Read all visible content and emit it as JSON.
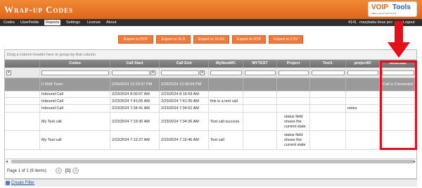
{
  "header": {
    "title": "Wrap-up Codes"
  },
  "logo": {
    "voip": "VOIP",
    "tools": "Tools",
    "tagline": "Making Cloud VoIP Simple"
  },
  "nav": {
    "items": [
      "Codes",
      "UserFields",
      "Reports",
      "Settings",
      "License",
      "About"
    ],
    "active": "Reports",
    "user_id": "4141",
    "user_name": "marybabu linux pro",
    "logout": "Logout"
  },
  "exports": [
    "Export to PDF",
    "Export to XLS",
    "Export to XLSX",
    "Export to RTF",
    "Export to CSV"
  ],
  "grid": {
    "group_hint": "Drag a column header here to group by that column",
    "columns": [
      "Codes",
      "Call Start",
      "Call End",
      "MyNewWC",
      "MYTEST",
      "Project",
      "Test1",
      "projectID",
      "NewLead"
    ],
    "rows": [
      [
        "II Shift Team",
        "2/26/2024 12:33:37 PM",
        "2/26/2024 12:36:04 PM",
        "",
        "",
        "",
        "",
        "",
        "Call is Connected"
      ],
      [
        "Inbound Call",
        "2/23/2024 8:00:07 AM",
        "2/23/2024 8:15:09 AM",
        "",
        "",
        "",
        "",
        "",
        ""
      ],
      [
        "Inbound Call",
        "2/23/2024 7:41:05 AM",
        "2/23/2024 7:41:35 AM",
        "this is a text call",
        "",
        "",
        "",
        "",
        ""
      ],
      [
        "Inbound Call",
        "2/23/2024 7:34:41 AM",
        "2/23/2024 7:34:52 AM",
        "",
        "",
        "",
        "",
        "notes",
        ""
      ],
      [
        "My Test call",
        "2/23/2024 7:19:30 AM",
        "2/23/2024 7:34:36 AM",
        "Test call success",
        "",
        "status field shows the current state",
        "",
        "",
        ""
      ],
      [
        "My Test call",
        "2/23/2024 7:13:27 AM",
        "2/23/2024 7:15:46 AM",
        "Test call",
        "",
        "status field shows the current state",
        "",
        "",
        ""
      ]
    ]
  },
  "pager": {
    "summary": "Page 1 of 1 (6 items)",
    "prev": "‹",
    "current": "[1]",
    "next": "›"
  },
  "footer": {
    "create_filter": "Create Filter"
  },
  "colors": {
    "header": "#e0651a",
    "navbar": "#2f2f2f",
    "export": "#ef7a3a",
    "highlight": "#e3101a"
  }
}
